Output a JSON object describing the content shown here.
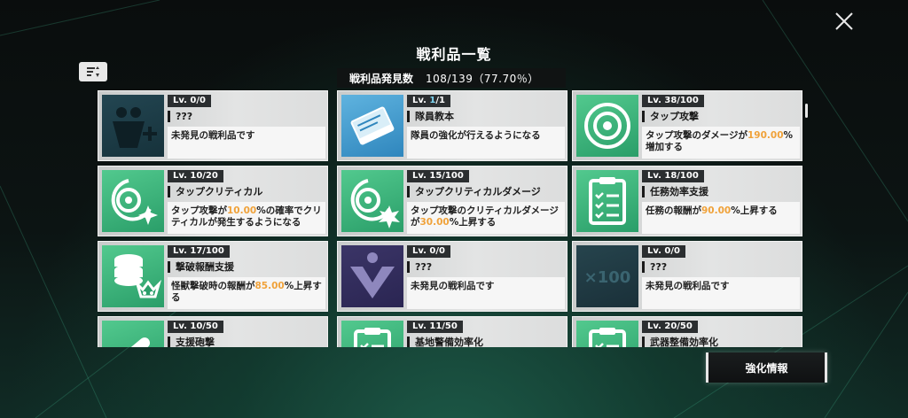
{
  "title": "戦利品一覧",
  "summary": {
    "label": "戦利品発見数",
    "value": "108/139（77.70％）"
  },
  "enhance_button": "強化情報",
  "cards": [
    {
      "lv_prefix": "Lv. ",
      "cur": "0",
      "max": "/0",
      "name": "???",
      "desc": [
        "未発見の戦利品です"
      ],
      "icon": "family-plus-icon"
    },
    {
      "lv_prefix": "Lv. ",
      "cur": "1",
      "max": "/1",
      "name": "隊員教本",
      "desc": [
        "隊員の強化が行えるようになる"
      ],
      "icon": "book-icon"
    },
    {
      "lv_prefix": "Lv. ",
      "cur": "38",
      "max": "/100",
      "name": "タップ攻撃",
      "desc": [
        "タップ攻撃のダメージが",
        "190.00",
        "%増加する"
      ],
      "icon": "target-icon"
    },
    {
      "lv_prefix": "Lv. ",
      "cur": "10",
      "max": "/20",
      "name": "タップクリティカル",
      "desc": [
        "タップ攻撃が",
        "10.00",
        "%の確率でクリティカルが発生するようになる"
      ],
      "icon": "target-sparkle-icon"
    },
    {
      "lv_prefix": "Lv. ",
      "cur": "15",
      "max": "/100",
      "name": "タップクリティカルダメージ",
      "desc": [
        "タップ攻撃のクリティカルダメージが",
        "30.00",
        "%上昇する"
      ],
      "icon": "target-burst-icon"
    },
    {
      "lv_prefix": "Lv. ",
      "cur": "18",
      "max": "/100",
      "name": "任務効率支援",
      "desc": [
        "任務の報酬が",
        "90.00",
        "%上昇する"
      ],
      "icon": "clipboard-icon"
    },
    {
      "lv_prefix": "Lv. ",
      "cur": "17",
      "max": "/100",
      "name": "撃破報酬支援",
      "desc": [
        "怪獣撃破時の報酬が",
        "85.00",
        "%上昇する"
      ],
      "icon": "coins-monster-icon"
    },
    {
      "lv_prefix": "Lv. ",
      "cur": "0",
      "max": "/0",
      "name": "???",
      "desc": [
        "未発見の戦利品です"
      ],
      "icon": "chevron-emblem-icon"
    },
    {
      "lv_prefix": "Lv. ",
      "cur": "0",
      "max": "/0",
      "name": "???",
      "desc": [
        "未発見の戦利品です"
      ],
      "icon": "x100-icon",
      "icon_text": "×100"
    },
    {
      "lv_prefix": "Lv. ",
      "cur": "10",
      "max": "/50",
      "name": "支援砲撃",
      "desc": [
        ""
      ],
      "icon": "cannon-icon"
    },
    {
      "lv_prefix": "Lv. ",
      "cur": "11",
      "max": "/50",
      "name": "基地警備効率化",
      "desc": [
        ""
      ],
      "icon": "clipboard-icon"
    },
    {
      "lv_prefix": "Lv. ",
      "cur": "20",
      "max": "/50",
      "name": "武器整備効率化",
      "desc": [
        ""
      ],
      "icon": "clipboard-icon"
    }
  ],
  "colors": {
    "accent_orange": "#f0a23a",
    "highlight_blue": "#7fd6f2"
  }
}
